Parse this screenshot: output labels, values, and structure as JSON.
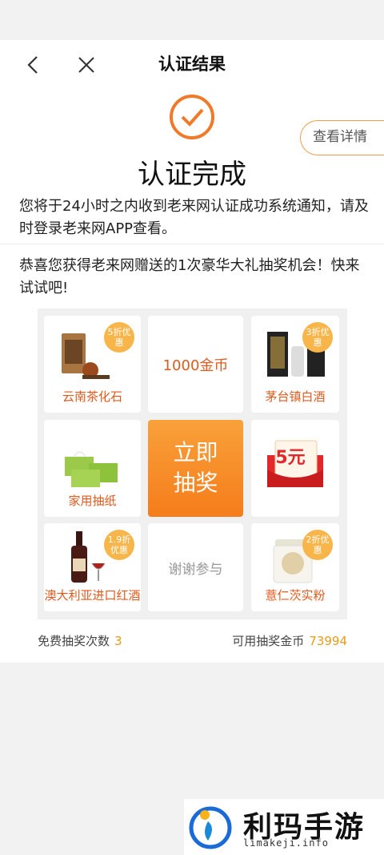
{
  "nav": {
    "title": "认证结果"
  },
  "detail_button": "查看详情",
  "main_title": "认证完成",
  "notice": "您将于24小时之内收到老来网认证成功系统通知，请及时登录老来网APP查看。",
  "congrats": "恭喜您获得老来网赠送的1次豪华大礼抽奖机会！快来试试吧!",
  "prizes": [
    {
      "label": "云南茶化石",
      "badge": "5折优惠",
      "icon": "tea-package-icon"
    },
    {
      "label": "1000金币",
      "icon": ""
    },
    {
      "label": "茅台镇白酒",
      "badge": "3折优惠",
      "icon": "liquor-box-icon"
    },
    {
      "label": "家用抽纸",
      "icon": "tissue-box-icon"
    },
    {
      "label": "5元",
      "icon": "red-envelope-icon"
    },
    {
      "label": "澳大利亚进口红酒",
      "badge": "1.9折优惠",
      "icon": "wine-bottle-icon"
    },
    {
      "label": "谢谢参与",
      "icon": ""
    },
    {
      "label": "薏仁茨实粉",
      "badge": "2折优惠",
      "icon": "powder-jar-icon"
    }
  ],
  "draw_button": {
    "line1": "立即",
    "line2": "抽奖"
  },
  "stats": {
    "free_label": "免费抽奖次数",
    "free_value": "3",
    "coin_label": "可用抽奖金币",
    "coin_value": "73994"
  },
  "watermark": {
    "title": "利玛手游",
    "subtitle": "limakeji.info"
  },
  "colors": {
    "accent": "#f57c1a",
    "label": "#e05a1c",
    "badge": "#f7b54a"
  }
}
